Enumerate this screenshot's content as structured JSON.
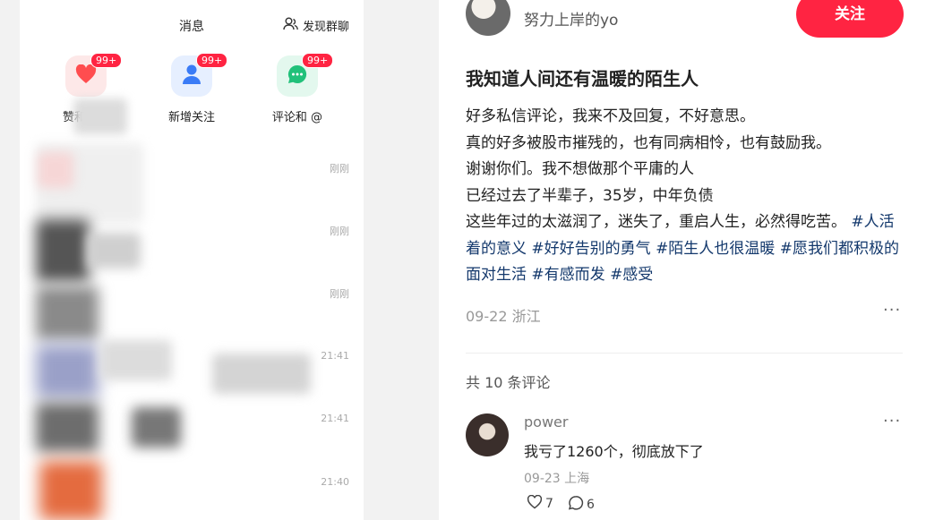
{
  "messages": {
    "title": "消息",
    "discover_label": "发现群聊",
    "quick_items": [
      {
        "label": "赞和收藏",
        "badge": "99+",
        "bg": "#fde8e8",
        "icon": "heart-icon",
        "color": "#ff4d4f"
      },
      {
        "label": "新增关注",
        "badge": "99+",
        "bg": "#e6efff",
        "icon": "user-icon",
        "color": "#3a7bf6"
      },
      {
        "label": "评论和 @",
        "badge": "99+",
        "bg": "#e3f8ee",
        "icon": "chat-icon",
        "color": "#21c17a"
      }
    ],
    "timestamps": [
      "刚刚",
      "刚刚",
      "刚刚",
      "21:41",
      "21:41",
      "21:40"
    ]
  },
  "post": {
    "author": "努力上岸的yo",
    "follow_label": "关注",
    "title": "我知道人间还有温暖的陌生人",
    "lines": [
      "好多私信评论，我来不及回复，不好意思。",
      "真的好多被股市摧残的，也有同病相怜，也有鼓励我。",
      "谢谢你们。我不想做那个平庸的人",
      "已经过去了半辈子，35岁，中年负债",
      "这些年过的太滋润了，迷失了，重启人生，必然得吃苦。"
    ],
    "tags": [
      "#人活着的意义",
      "#好好告别的勇气",
      "#陌生人也很温暖",
      "#愿我们都积极的面对生活",
      "#有感而发",
      "#感受"
    ],
    "meta": "09-22 浙江",
    "more": "···"
  },
  "comments": {
    "count_label": "共 10 条评论",
    "items": [
      {
        "user": "power",
        "text": "我亏了1260个，彻底放下了",
        "meta": "09-23 上海",
        "likes": "7",
        "replies": "6",
        "more": "···"
      }
    ]
  },
  "colors": {
    "accent": "#ff2442",
    "tag": "#13386c"
  }
}
